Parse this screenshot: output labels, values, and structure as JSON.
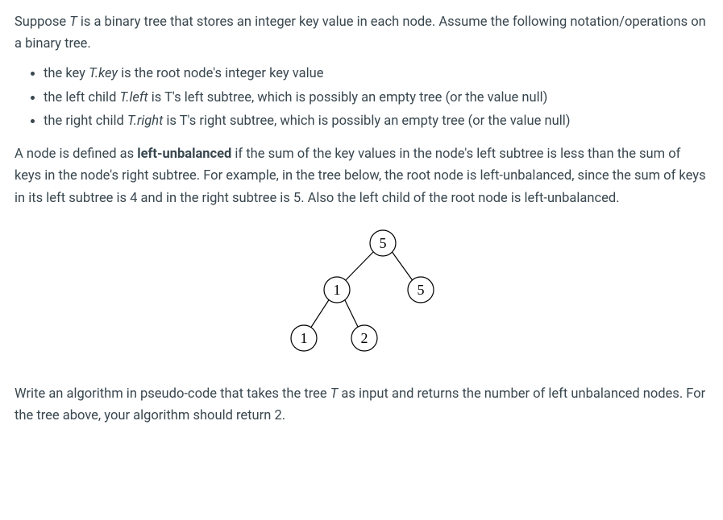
{
  "para1a": "Suppose ",
  "para1b": "T",
  "para1c": " is a binary tree that stores an integer key value in each node. Assume the following notation/operations on a binary tree.",
  "bullets": [
    {
      "pre": "the key ",
      "em": "T.key",
      "post": " is the root node's integer key value"
    },
    {
      "pre": "the left child ",
      "em": "T.left",
      "post": " is T's left subtree, which is possibly an empty tree (or the value null)"
    },
    {
      "pre": "the right child ",
      "em": "T.right",
      "post": " is T's right subtree, which is possibly an empty tree (or the value null)"
    }
  ],
  "para2a": "A node is defined as ",
  "para2b": "left-unbalanced",
  "para2c": " if the sum of the key values in the node's left subtree is less than the sum of keys in the node's right subtree. For example, in the tree below, the root node is left-unbalanced, since the sum of keys in its left subtree is 4 and in the right subtree is 5. Also the left child of the root node is left-unbalanced.",
  "tree": {
    "root": "5",
    "left": "1",
    "right": "5",
    "leftleft": "1",
    "leftright": "2"
  },
  "para3a": "Write an algorithm in pseudo-code that takes the tree ",
  "para3b": "T",
  "para3c": " as input and returns the number of left unbalanced nodes. For the tree above, your algorithm should return 2."
}
